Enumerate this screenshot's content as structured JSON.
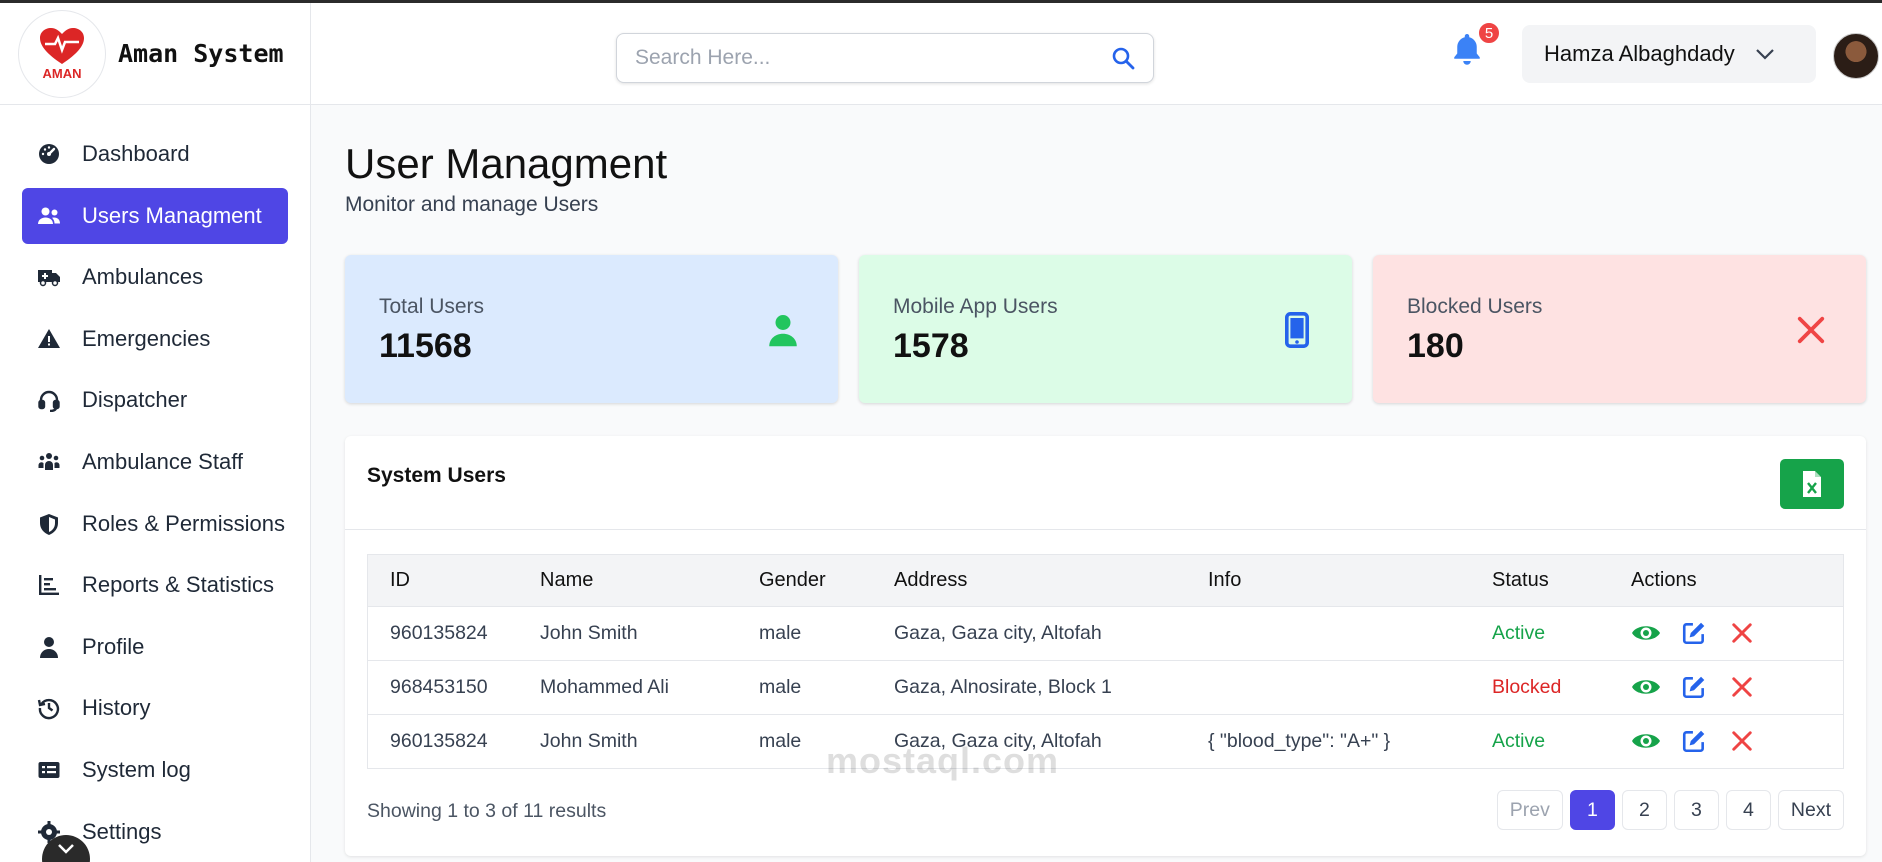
{
  "brand": {
    "title": "Aman System",
    "logo_text": "AMAN"
  },
  "sidebar": {
    "items": [
      {
        "label": "Dashboard",
        "icon": "gauge-icon"
      },
      {
        "label": "Users Managment",
        "icon": "users-icon",
        "active": true
      },
      {
        "label": "Ambulances",
        "icon": "ambulance-icon"
      },
      {
        "label": "Emergencies",
        "icon": "warning-icon"
      },
      {
        "label": "Dispatcher",
        "icon": "headset-icon"
      },
      {
        "label": "Ambulance Staff",
        "icon": "staff-icon"
      },
      {
        "label": "Roles & Permissions",
        "icon": "shield-icon"
      },
      {
        "label": "Reports & Statistics",
        "icon": "chart-icon"
      },
      {
        "label": "Profile",
        "icon": "user-icon"
      },
      {
        "label": "History",
        "icon": "history-icon"
      },
      {
        "label": "System log",
        "icon": "log-icon"
      },
      {
        "label": "Settings",
        "icon": "gear-icon"
      }
    ]
  },
  "header": {
    "search_placeholder": "Search Here...",
    "notification_count": "5",
    "user_name": "Hamza Albaghdady"
  },
  "page": {
    "title": "User Managment",
    "subtitle": "Monitor and manage Users"
  },
  "stats": [
    {
      "label": "Total Users",
      "value": "11568",
      "icon": "user-icon",
      "color": "#22c55e"
    },
    {
      "label": "Mobile App Users",
      "value": "1578",
      "icon": "mobile-icon",
      "color": "#2563eb"
    },
    {
      "label": "Blocked Users",
      "value": "180",
      "icon": "close-icon",
      "color": "#ef4444"
    }
  ],
  "table": {
    "title": "System Users",
    "columns": [
      "ID",
      "Name",
      "Gender",
      "Address",
      "Info",
      "Status",
      "Actions"
    ],
    "rows": [
      {
        "id": "960135824",
        "name": "John Smith",
        "gender": "male",
        "address": "Gaza, Gaza city, Altofah",
        "info": "",
        "status": "Active"
      },
      {
        "id": "968453150",
        "name": "Mohammed Ali",
        "gender": "male",
        "address": "Gaza, Alnosirate, Block 1",
        "info": "",
        "status": "Blocked"
      },
      {
        "id": "960135824",
        "name": "John Smith",
        "gender": "male",
        "address": "Gaza, Gaza city, Altofah",
        "info": "{ \"blood_type\": \"A+\" }",
        "status": "Active"
      }
    ],
    "showing": "Showing 1 to 3 of 11 results"
  },
  "pagination": {
    "prev": "Prev",
    "pages": [
      "1",
      "2",
      "3",
      "4"
    ],
    "current": "1",
    "next": "Next"
  },
  "watermark": "mostaql.com",
  "colors": {
    "accent": "#4f46e5",
    "success": "#16a34a",
    "danger": "#dc2626"
  }
}
